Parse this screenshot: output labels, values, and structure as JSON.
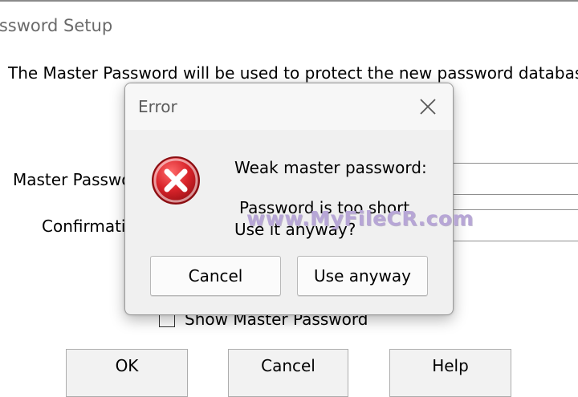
{
  "window": {
    "title": "assword Setup",
    "description": "The Master Password will be used to protect the new password database f",
    "master_password_label": "Master Passwo",
    "confirmation_label": "Confirmatio",
    "show_master_password_label": "Show Master Password",
    "show_master_password_checked": false,
    "buttons": {
      "ok": "OK",
      "cancel": "Cancel",
      "help": "Help"
    }
  },
  "error_dialog": {
    "title": "Error",
    "icon": "error-x-icon",
    "message_line1": "Weak master password:",
    "message_line2": "Password is too short.",
    "message_line3": "Use it anyway?",
    "buttons": {
      "cancel": "Cancel",
      "use_anyway": "Use anyway"
    }
  },
  "watermark": "www.MyFileCR.com",
  "colors": {
    "error_red": "#d8232a",
    "dialog_bg": "#f7f7f7",
    "watermark": "#b7a6d6"
  }
}
